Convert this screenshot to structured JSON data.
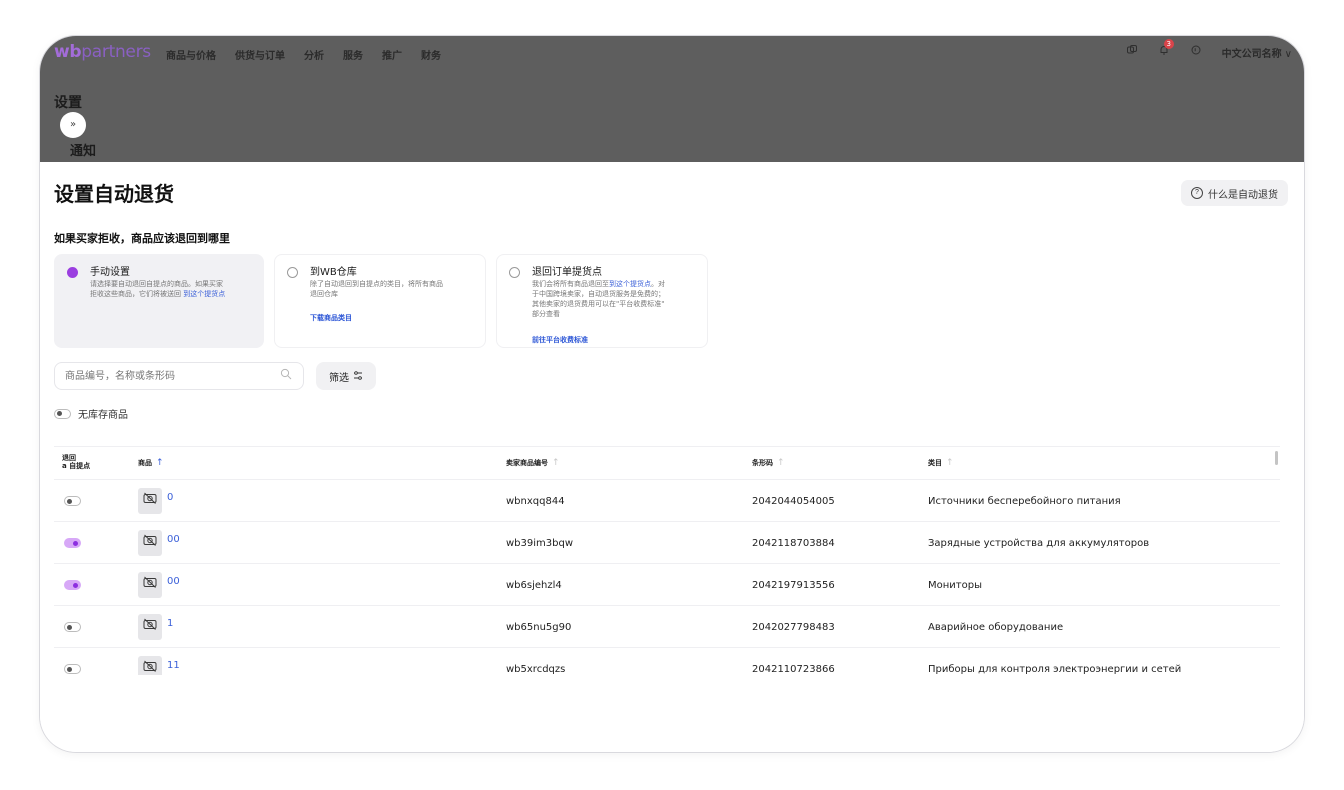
{
  "header": {
    "logo_wb": "wb",
    "logo_rest": "partners",
    "nav": [
      "商品与价格",
      "供货与订单",
      "分析",
      "服务",
      "推广",
      "财务"
    ],
    "notification_count": "3",
    "company": "中文公司名称",
    "company_chevron": "∨"
  },
  "breadcrumb": {
    "settings": "设置",
    "collapse": "»",
    "notifications": "通知"
  },
  "page": {
    "title": "设置自动退货",
    "help_button": "什么是自动退货",
    "subtitle": "如果买家拒收，商品应该退回到哪里"
  },
  "options": [
    {
      "title": "手动设置",
      "desc_line1": "请选择要自动退回自提点的商品。如果买家",
      "desc_line2": "拒收这些商品，它们将被送回",
      "desc_link": "到这个提货点",
      "selected": true
    },
    {
      "title": "到WB仓库",
      "desc_line1": "除了自动退回到自提点的类目，将所有商品",
      "desc_line2": "退回仓库",
      "link": "下载商品类目",
      "selected": false
    },
    {
      "title": "退回订单提货点",
      "desc_line1_pre": "我们会将所有商品退回至",
      "desc_line1_link": "到这个提货点",
      "desc_line1_post": "。对",
      "desc_line2": "于中国跨境卖家，自动退货服务是免费的；",
      "desc_line3": "其他卖家的退货费用可以在\"平台收费标准\"",
      "desc_line4": "部分查看",
      "link": "前往平台收费标准",
      "selected": false
    }
  ],
  "search": {
    "placeholder": "商品编号，名称或条形码"
  },
  "filter_label": "筛选",
  "no_stock_label": "无库存商品",
  "table": {
    "headers": {
      "return_line1": "退回",
      "return_line2": "a 自提点",
      "product": "商品",
      "seller_code": "卖家商品编号",
      "barcode": "条形码",
      "category": "类目"
    },
    "rows": [
      {
        "toggle": false,
        "name": "0",
        "code": "wbnxqq844",
        "barcode": "2042044054005",
        "category": "Источники бесперебойного питания"
      },
      {
        "toggle": true,
        "name": "00",
        "code": "wb39im3bqw",
        "barcode": "2042118703884",
        "category": "Зарядные устройства для аккумуляторов"
      },
      {
        "toggle": true,
        "name": "00",
        "code": "wb6sjehzl4",
        "barcode": "2042197913556",
        "category": "Мониторы"
      },
      {
        "toggle": false,
        "name": "1",
        "code": "wb65nu5g90",
        "barcode": "2042027798483",
        "category": "Аварийное оборудование"
      },
      {
        "toggle": false,
        "name": "11",
        "code": "wb5xrcdqzs",
        "barcode": "2042110723866",
        "category": "Приборы для контроля электроэнергии и сетей"
      }
    ]
  },
  "colors": {
    "accent": "#9b3fe0",
    "link": "#3a5fd8",
    "overlay": "#5e5e5e"
  }
}
